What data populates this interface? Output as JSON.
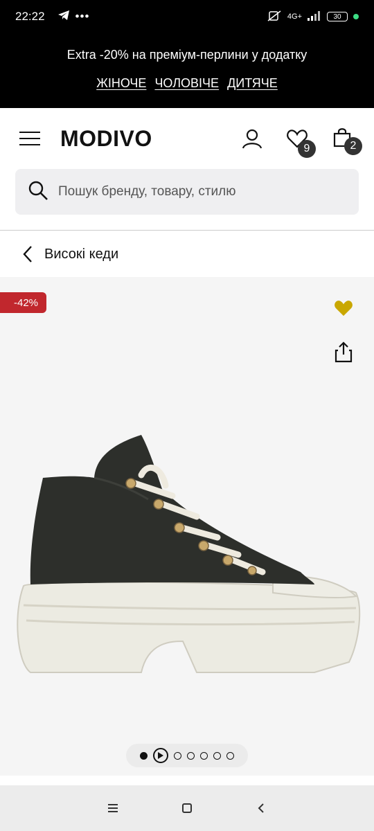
{
  "status": {
    "time": "22:22",
    "network": "4G+",
    "battery": "30"
  },
  "promo": {
    "text": "Extra -20% на преміум-перлини у додатку",
    "links": [
      "ЖІНОЧЕ",
      "ЧОЛОВІЧЕ",
      "ДИТЯЧЕ"
    ]
  },
  "header": {
    "logo": "MODIVO",
    "wishlist_count": "9",
    "cart_count": "2"
  },
  "search": {
    "placeholder": "Пошук бренду, товару, стилю"
  },
  "breadcrumb": {
    "title": "Високі кеди"
  },
  "product": {
    "discount": "-42%",
    "gallery_dots": 7,
    "active_index": 0
  },
  "colors": {
    "discount": "#c1272d",
    "heart": "#c9a700",
    "promo_bg": "#000000"
  },
  "icons": [
    "telegram-icon",
    "menu-icon",
    "user-icon",
    "heart-icon",
    "bag-icon",
    "search-icon",
    "chevron-left-icon",
    "share-icon",
    "play-icon"
  ]
}
